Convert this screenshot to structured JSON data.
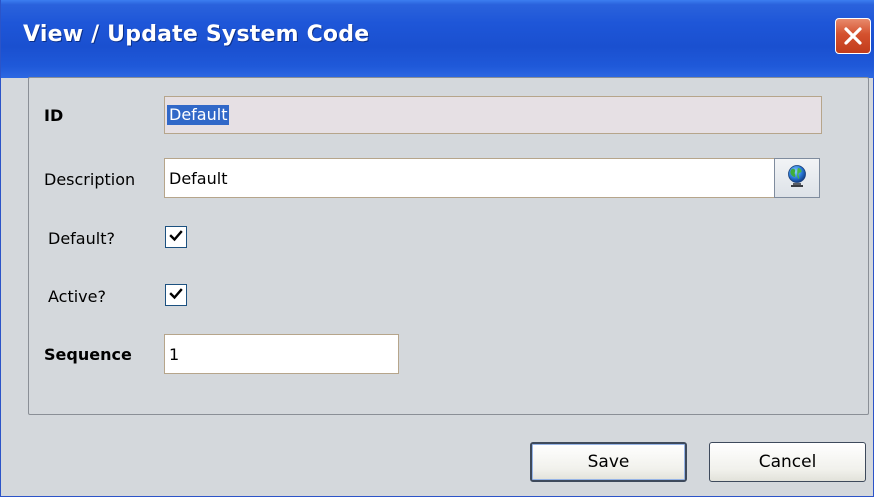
{
  "dialog": {
    "title": "View / Update System Code",
    "close_icon": "close-icon"
  },
  "form": {
    "id": {
      "label": "ID",
      "value": "Default",
      "selected": true
    },
    "description": {
      "label": "Description",
      "value": "Default",
      "translate_icon": "globe-icon"
    },
    "default_flag": {
      "label": "Default?",
      "checked": true
    },
    "active_flag": {
      "label": "Active?",
      "checked": true
    },
    "sequence": {
      "label": "Sequence",
      "value": "1"
    }
  },
  "buttons": {
    "save_label": "Save",
    "cancel_label": "Cancel"
  },
  "colors": {
    "titlebar": "#1f59d9",
    "dialog_background": "#d4d8dc",
    "selection": "#3168c8",
    "close_button": "#d4512e"
  }
}
